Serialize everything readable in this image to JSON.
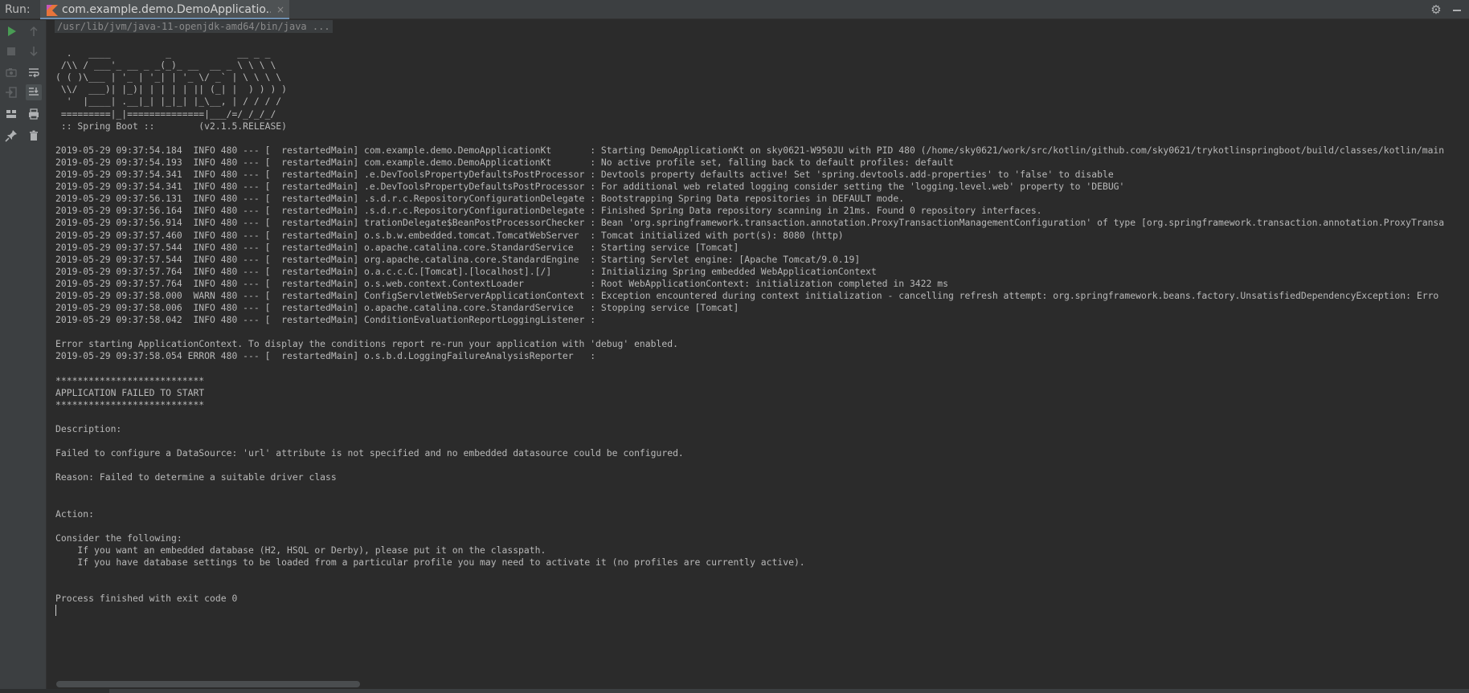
{
  "header": {
    "run_label": "Run:",
    "tab_title": "com.example.demo.DemoApplicatio...",
    "tab_close": "×",
    "settings_icon": "gear-icon",
    "minimize_icon": "minimize-icon"
  },
  "toolbar": {
    "items": [
      {
        "name": "rerun-icon",
        "active": true
      },
      {
        "name": "scroll-up-icon",
        "active": false
      },
      {
        "name": "stop-icon",
        "active": false
      },
      {
        "name": "scroll-down-icon",
        "active": false
      },
      {
        "name": "soft-wrap-icon",
        "active": false
      },
      {
        "name": "camera-icon",
        "active": false
      },
      {
        "name": "scroll-to-end-icon",
        "active": true
      },
      {
        "name": "exit-icon",
        "active": false
      },
      {
        "name": "print-icon",
        "active": false
      },
      {
        "name": "layout-icon",
        "active": false
      },
      {
        "name": "delete-icon",
        "active": false
      },
      {
        "name": "pin-icon",
        "active": false
      }
    ]
  },
  "console": {
    "command": "/usr/lib/jvm/java-11-openjdk-amd64/bin/java ...",
    "lines": [
      "",
      "  .   ____          _            __ _ _",
      " /\\\\ / ___'_ __ _ _(_)_ __  __ _ \\ \\ \\ \\",
      "( ( )\\___ | '_ | '_| | '_ \\/ _` | \\ \\ \\ \\",
      " \\\\/  ___)| |_)| | | | | || (_| |  ) ) ) )",
      "  '  |____| .__|_| |_|_| |_\\__, | / / / /",
      " =========|_|==============|___/=/_/_/_/",
      " :: Spring Boot ::        (v2.1.5.RELEASE)",
      "",
      "2019-05-29 09:37:54.184  INFO 480 --- [  restartedMain] com.example.demo.DemoApplicationKt       : Starting DemoApplicationKt on sky0621-W950JU with PID 480 (/home/sky0621/work/src/kotlin/github.com/sky0621/trykotlinspringboot/build/classes/kotlin/main",
      "2019-05-29 09:37:54.193  INFO 480 --- [  restartedMain] com.example.demo.DemoApplicationKt       : No active profile set, falling back to default profiles: default",
      "2019-05-29 09:37:54.341  INFO 480 --- [  restartedMain] .e.DevToolsPropertyDefaultsPostProcessor : Devtools property defaults active! Set 'spring.devtools.add-properties' to 'false' to disable",
      "2019-05-29 09:37:54.341  INFO 480 --- [  restartedMain] .e.DevToolsPropertyDefaultsPostProcessor : For additional web related logging consider setting the 'logging.level.web' property to 'DEBUG'",
      "2019-05-29 09:37:56.131  INFO 480 --- [  restartedMain] .s.d.r.c.RepositoryConfigurationDelegate : Bootstrapping Spring Data repositories in DEFAULT mode.",
      "2019-05-29 09:37:56.164  INFO 480 --- [  restartedMain] .s.d.r.c.RepositoryConfigurationDelegate : Finished Spring Data repository scanning in 21ms. Found 0 repository interfaces.",
      "2019-05-29 09:37:56.914  INFO 480 --- [  restartedMain] trationDelegate$BeanPostProcessorChecker : Bean 'org.springframework.transaction.annotation.ProxyTransactionManagementConfiguration' of type [org.springframework.transaction.annotation.ProxyTransa",
      "2019-05-29 09:37:57.460  INFO 480 --- [  restartedMain] o.s.b.w.embedded.tomcat.TomcatWebServer  : Tomcat initialized with port(s): 8080 (http)",
      "2019-05-29 09:37:57.544  INFO 480 --- [  restartedMain] o.apache.catalina.core.StandardService   : Starting service [Tomcat]",
      "2019-05-29 09:37:57.544  INFO 480 --- [  restartedMain] org.apache.catalina.core.StandardEngine  : Starting Servlet engine: [Apache Tomcat/9.0.19]",
      "2019-05-29 09:37:57.764  INFO 480 --- [  restartedMain] o.a.c.c.C.[Tomcat].[localhost].[/]       : Initializing Spring embedded WebApplicationContext",
      "2019-05-29 09:37:57.764  INFO 480 --- [  restartedMain] o.s.web.context.ContextLoader            : Root WebApplicationContext: initialization completed in 3422 ms",
      "2019-05-29 09:37:58.000  WARN 480 --- [  restartedMain] ConfigServletWebServerApplicationContext : Exception encountered during context initialization - cancelling refresh attempt: org.springframework.beans.factory.UnsatisfiedDependencyException: Erro",
      "2019-05-29 09:37:58.006  INFO 480 --- [  restartedMain] o.apache.catalina.core.StandardService   : Stopping service [Tomcat]",
      "2019-05-29 09:37:58.042  INFO 480 --- [  restartedMain] ConditionEvaluationReportLoggingListener :",
      "",
      "Error starting ApplicationContext. To display the conditions report re-run your application with 'debug' enabled.",
      "2019-05-29 09:37:58.054 ERROR 480 --- [  restartedMain] o.s.b.d.LoggingFailureAnalysisReporter   :",
      "",
      "***************************",
      "APPLICATION FAILED TO START",
      "***************************",
      "",
      "Description:",
      "",
      "Failed to configure a DataSource: 'url' attribute is not specified and no embedded datasource could be configured.",
      "",
      "Reason: Failed to determine a suitable driver class",
      "",
      "",
      "Action:",
      "",
      "Consider the following:",
      "    If you want an embedded database (H2, HSQL or Derby), please put it on the classpath.",
      "    If you have database settings to be loaded from a particular profile you may need to activate it (no profiles are currently active).",
      "",
      "",
      "Process finished with exit code 0"
    ]
  }
}
